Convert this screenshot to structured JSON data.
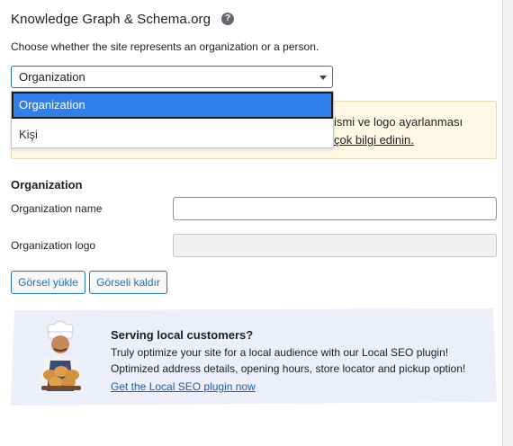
{
  "header": {
    "title": "Knowledge Graph & Schema.org",
    "help_icon": "?",
    "description": "Choose whether the site represents an organization or a person."
  },
  "site_type_select": {
    "value": "Organization",
    "options": [
      "Organization",
      "Kişi"
    ],
    "highlighted": "Organization"
  },
  "notice": {
    "line1": "ismi ve logo ayarlanması",
    "link": "çok bilgi edinin."
  },
  "organization": {
    "heading": "Organization",
    "name_label": "Organization name",
    "name_value": "",
    "logo_label": "Organization logo",
    "logo_value": "",
    "upload_button": "Görsel yükle",
    "remove_button": "Görseli kaldır"
  },
  "promo": {
    "title": "Serving local customers?",
    "text1": "Truly optimize your site for a local audience with our Local SEO plugin!",
    "text2": "Optimized address details, opening hours, store locator and pickup option!",
    "link": "Get the Local SEO plugin now"
  },
  "colors": {
    "accent": "#2271b1",
    "selected_option": "#2f80ed",
    "notice_bg": "#fff8e5",
    "promo_bg": "#eceefa"
  }
}
